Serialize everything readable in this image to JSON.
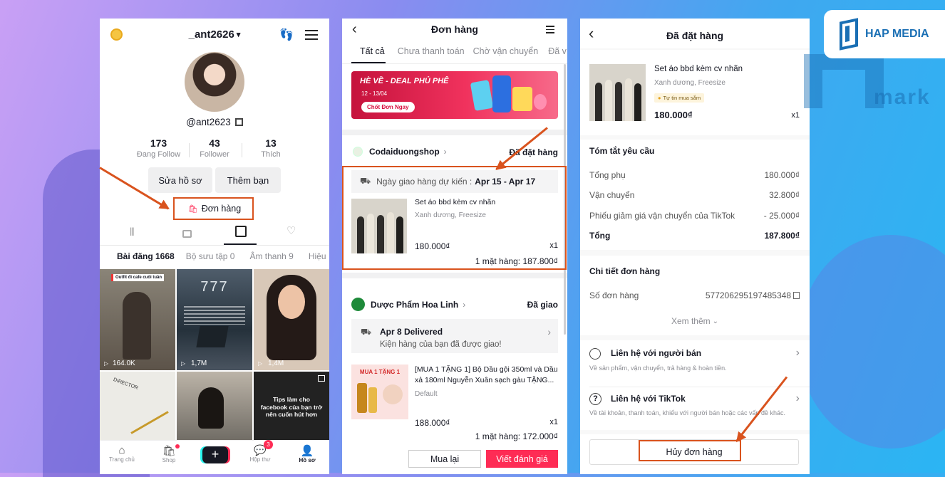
{
  "profile": {
    "username": "_ant2626",
    "handle": "@ant2623",
    "stats": [
      {
        "value": "173",
        "label": "Đang Follow"
      },
      {
        "value": "43",
        "label": "Follower"
      },
      {
        "value": "13",
        "label": "Thích"
      }
    ],
    "edit_btn": "Sửa hồ sơ",
    "add_friend_btn": "Thêm bạn",
    "orders_btn": "Đơn hàng",
    "tabs": [
      "Bài đăng 1668",
      "Bộ sưu tập 0",
      "Âm thanh 9",
      "Hiệu"
    ],
    "videos": [
      {
        "caption": "Outfit đi cafe cuối tuần",
        "views": "164.0K"
      },
      {
        "caption": "777",
        "views": "1,7M"
      },
      {
        "caption": "",
        "views": "1,4M"
      },
      {
        "caption": "DIRECTOR",
        "views": ""
      },
      {
        "caption": "",
        "views": ""
      },
      {
        "caption": "Tips làm cho facebook của bạn trở nên cuốn hút hơn",
        "views": ""
      }
    ],
    "nav": [
      "Trang chủ",
      "Shop",
      "",
      "Hộp thư",
      "Hồ sơ"
    ],
    "inbox_badge": "3"
  },
  "orders": {
    "title": "Đơn hàng",
    "tabs": [
      "Tất cả",
      "Chưa thanh toán",
      "Chờ vận chuyển",
      "Đã v"
    ],
    "banner": {
      "headline": "HÈ VỀ - DEAL PHỦ PHÊ",
      "date": "12 - 13/04",
      "cta": "Chốt Đơn Ngay"
    },
    "order1": {
      "shop": "Codaiduongshop",
      "status": "Đã đặt hàng",
      "delivery_label": "Ngày giao hàng dự kiến :",
      "delivery_date": "Apr 15 - Apr 17",
      "product": "Set áo bbd kèm cv nhãn",
      "variant": "Xanh dương, Freesize",
      "price": "180.000₫",
      "qty": "x1",
      "total": "1 mặt hàng: 187.800₫"
    },
    "order2": {
      "shop": "Dược Phẩm Hoa Linh",
      "status": "Đã giao",
      "delivery_title": "Apr 8 Delivered",
      "delivery_sub": "Kiện hàng của bạn đã được giao!",
      "product": "[MUA 1 TẶNG 1] Bộ Dầu gội 350ml và Dầu xả 180ml Nguyễn Xuân sạch gàu TẶNG...",
      "variant": "Default",
      "price": "188.000₫",
      "qty": "x1",
      "total": "1 mặt hàng: 172.000₫",
      "img_text": "MUA 1 TẶNG 1"
    },
    "buy_again": "Mua lại",
    "write_review": "Viết đánh giá"
  },
  "detail": {
    "title": "Đã đặt hàng",
    "product": "Set áo bbd kèm cv nhãn",
    "variant": "Xanh dương, Freesize",
    "badge": "Tự tin mua sắm",
    "price": "180.000₫",
    "qty": "x1",
    "summary_title": "Tóm tắt yêu cầu",
    "summary": [
      {
        "label": "Tổng phụ",
        "value": "180.000₫"
      },
      {
        "label": "Vận chuyển",
        "value": "32.800₫"
      },
      {
        "label": "Phiếu giảm giá vận chuyển của TikTok",
        "value": "- 25.000₫"
      }
    ],
    "total_label": "Tổng",
    "total_value": "187.800₫",
    "order_detail_title": "Chi tiết đơn hàng",
    "order_no_label": "Số đơn hàng",
    "order_no": "577206295197485348",
    "more": "Xem thêm",
    "contact_seller": "Liên hệ với người bán",
    "contact_seller_sub": "Về sản phẩm, vận chuyển, trả hàng & hoàn tiền.",
    "contact_tiktok": "Liên hệ với TikTok",
    "contact_tiktok_sub": "Về tài khoản, thanh toán, khiếu với người bán hoặc các vấn đề khác.",
    "cancel_btn": "Hủy đơn hàng"
  },
  "brand": {
    "name": "HAP MEDIA",
    "watermark": "mark",
    "accent": "#1a6fb4"
  },
  "colors": {
    "highlight": "#d9531e",
    "tiktok_red": "#fe2c55"
  }
}
